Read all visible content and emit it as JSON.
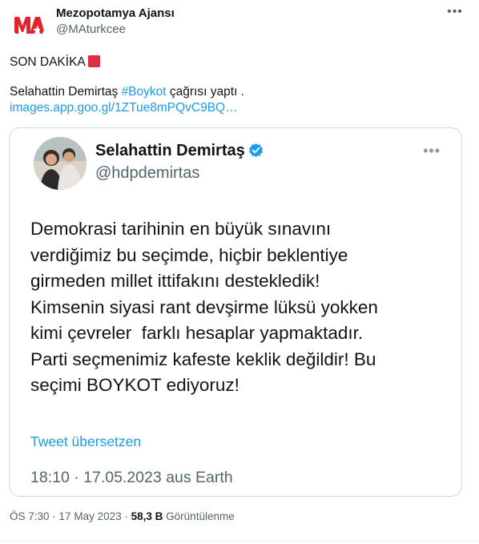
{
  "author": {
    "name": "Mezopotamya Ajansı",
    "handle": "@MAturkcee",
    "logo_text": "MA",
    "logo_color": "#e4222a"
  },
  "tweet": {
    "line1": "SON DAKİKA",
    "line2_prefix": "Selahattin Demirtaş ",
    "line2_hashtag": "#Boykot",
    "line2_suffix": " çağrısı yaptı .",
    "link": "images.app.goo.gl/1ZTue8mPQvC9BQ…"
  },
  "embedded": {
    "name": "Selahattin Demirtaş",
    "handle": "@hdpdemirtas",
    "body_lines": [
      "Demokrasi tarihinin en büyük sınavını",
      "verdiğimiz bu seçimde, hiçbir beklentiye",
      "girmeden millet ittifakını destekledik!",
      "Kimsenin siyasi rant devşirme lüksü yokken",
      "kimi çevreler  farklı hesaplar yapmaktadır.",
      "Parti seçmenimiz kafeste keklik değildir! Bu",
      "seçimi BOYKOT ediyoruz!"
    ],
    "translate_label": "Tweet übersetzen",
    "meta": "18:10 · 17.05.2023 aus Earth"
  },
  "meta": {
    "time": "ÖS 7:30",
    "date": "17 May 2023",
    "views_count": "58,3 B",
    "views_label": "Görüntülenme"
  },
  "colors": {
    "accent": "#1d9bf0",
    "text": "#0f1419",
    "secondary": "#536471",
    "border": "#cfd9de",
    "emoji_red": "#dd2e44"
  }
}
